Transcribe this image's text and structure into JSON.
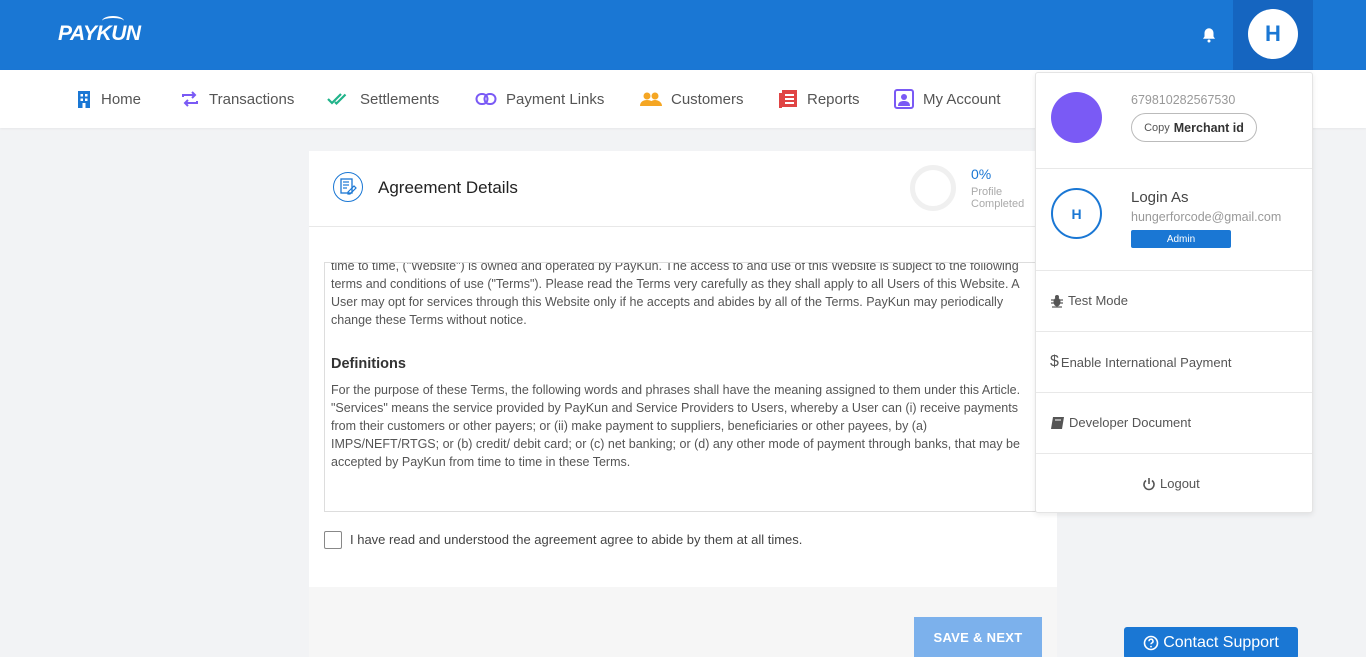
{
  "brand": {
    "logo_text": "PAYKUN"
  },
  "header": {
    "avatar_initial": "H"
  },
  "nav": {
    "items": [
      {
        "label": "Home",
        "icon": "building-icon",
        "color": "#1a77d4"
      },
      {
        "label": "Transactions",
        "icon": "repeat-icon",
        "color": "#7a5af5"
      },
      {
        "label": "Settlements",
        "icon": "double-check-icon",
        "color": "#21b38a"
      },
      {
        "label": "Payment Links",
        "icon": "link-icon",
        "color": "#7a5af5"
      },
      {
        "label": "Customers",
        "icon": "users-icon",
        "color": "#f5a623"
      },
      {
        "label": "Reports",
        "icon": "report-icon",
        "color": "#e04444"
      },
      {
        "label": "My Account",
        "icon": "account-icon",
        "color": "#7a5af5"
      }
    ]
  },
  "card": {
    "title": "Agreement Details",
    "progress_value": "0%",
    "progress_label_1": "Profile",
    "progress_label_2": "Completed",
    "terms_para_1": "time to time, (\"Website\") is owned and operated by PayKun. The access to and use of this Website is subject to the following terms and conditions of use (\"Terms\"). Please read the Terms very carefully as they shall apply to all Users of this Website. A User may opt for services through this Website only if he accepts and abides by all of the Terms. PayKun may periodically change these Terms without notice.",
    "terms_heading": "Definitions",
    "terms_para_2": "For the purpose of these Terms, the following words and phrases shall have the meaning assigned to them under this Article. \"Services\" means the service provided by PayKun and Service Providers to Users, whereby a User can (i) receive payments from their customers or other payers; or (ii) make payment to suppliers, beneficiaries or other payees, by (a) IMPS/NEFT/RTGS; or (b) credit/ debit card; or (c) net banking; or (d) any other mode of payment through banks, that may be accepted by PayKun from time to time in these Terms.",
    "agree_text": "I have read and understood the agreement agree to abide by them at all times.",
    "save_label": "SAVE & NEXT"
  },
  "dropdown": {
    "merchant_id": "679810282567530",
    "copy_prefix": "Copy",
    "copy_label": "Merchant id",
    "login_initial": "H",
    "login_as": "Login As",
    "email": "hungerforcode@gmail.com",
    "role": "Admin",
    "test_mode": "Test Mode",
    "intl_payment": "Enable International Payment",
    "dev_doc": "Developer Document",
    "logout": "Logout"
  },
  "support": {
    "label": "Contact Support"
  },
  "colors": {
    "primary": "#1a77d4",
    "merchant_avatar": "#7a5af5"
  }
}
